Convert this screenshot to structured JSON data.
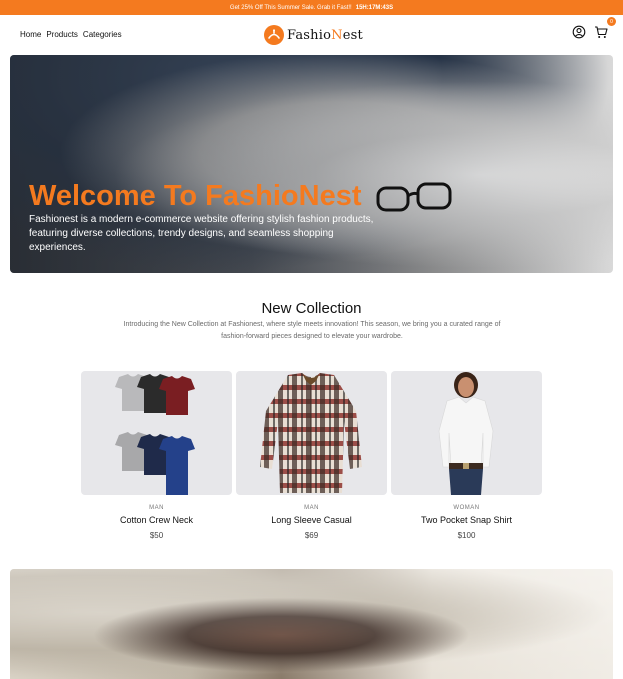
{
  "promo": {
    "text": "Get 25% Off This Summer Sale. Grab it Fast!!",
    "timer": "15H:17M:43S"
  },
  "nav": {
    "links": [
      "Home",
      "Products",
      "Categories"
    ],
    "logo_part1": "Fashio",
    "logo_accent": "N",
    "logo_part2": "est",
    "cart_count": "0"
  },
  "hero": {
    "title": "Welcome To FashioNest",
    "description": "Fashionest is a modern e-commerce website offering stylish fashion products, featuring diverse collections, trendy designs, and seamless shopping experiences."
  },
  "collection": {
    "title": "New Collection",
    "description": "Introducing the New Collection at Fashionest, where style meets innovation! This season, we bring you a curated range of fashion-forward pieces designed to elevate your wardrobe."
  },
  "products": [
    {
      "category": "MAN",
      "name": "Cotton Crew Neck",
      "price": "$50"
    },
    {
      "category": "MAN",
      "name": "Long Sleeve Casual",
      "price": "$69"
    },
    {
      "category": "WOMAN",
      "name": "Two Pocket Snap Shirt",
      "price": "$100"
    }
  ],
  "colors": {
    "accent": "#f47a1f",
    "card_bg": "#e7e7ea"
  },
  "icons": [
    "user-icon",
    "cart-icon",
    "logo-icon"
  ]
}
